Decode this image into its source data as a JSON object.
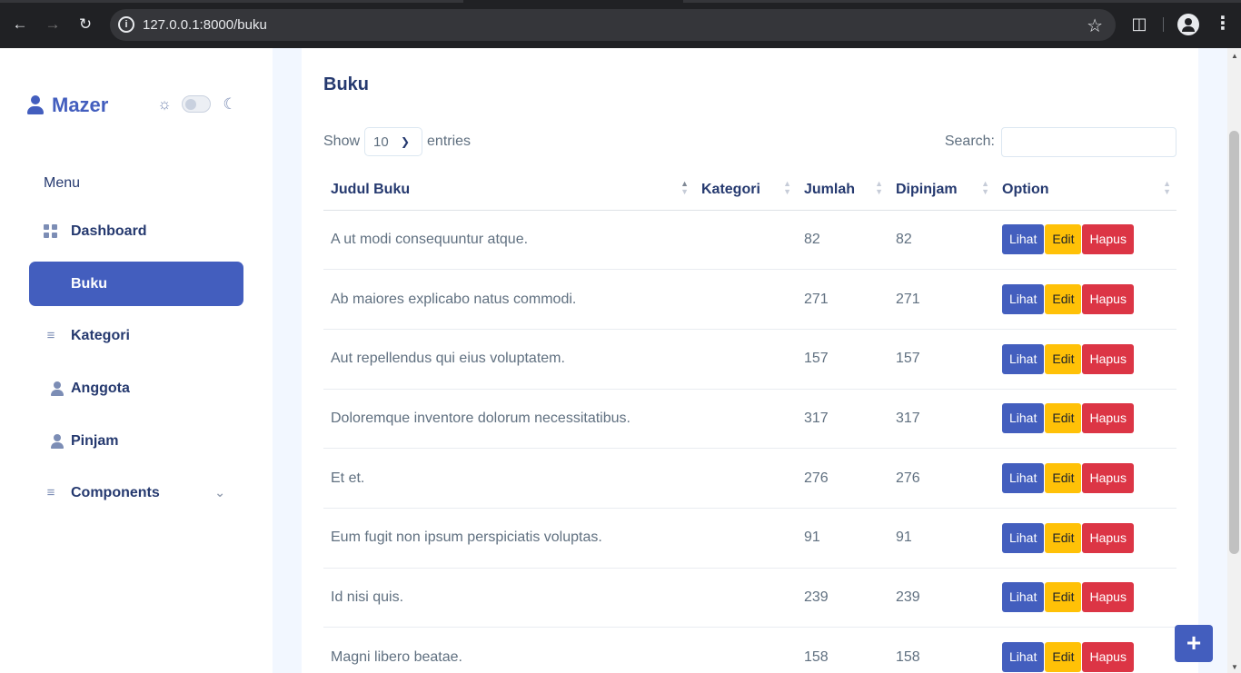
{
  "browser": {
    "url": "127.0.0.1:8000/buku"
  },
  "sidebar": {
    "brand": "Mazer",
    "menu_title": "Menu",
    "items": [
      {
        "label": "Dashboard"
      },
      {
        "label": "Buku"
      },
      {
        "label": "Kategori"
      },
      {
        "label": "Anggota"
      },
      {
        "label": "Pinjam"
      },
      {
        "label": "Components"
      }
    ],
    "active_item": "Buku"
  },
  "main": {
    "title": "Buku",
    "show_label": "Show",
    "entries_value": "10",
    "entries_label": "entries",
    "search_label": "Search:",
    "search_value": "",
    "columns": [
      "Judul Buku",
      "Kategori",
      "Jumlah",
      "Dipinjam",
      "Option"
    ],
    "rows": [
      {
        "judul": "A ut modi consequuntur atque.",
        "kategori": "",
        "jumlah": "82",
        "dipinjam": "82"
      },
      {
        "judul": "Ab maiores explicabo natus commodi.",
        "kategori": "",
        "jumlah": "271",
        "dipinjam": "271"
      },
      {
        "judul": "Aut repellendus qui eius voluptatem.",
        "kategori": "",
        "jumlah": "157",
        "dipinjam": "157"
      },
      {
        "judul": "Doloremque inventore dolorum necessitatibus.",
        "kategori": "",
        "jumlah": "317",
        "dipinjam": "317"
      },
      {
        "judul": "Et et.",
        "kategori": "",
        "jumlah": "276",
        "dipinjam": "276"
      },
      {
        "judul": "Eum fugit non ipsum perspiciatis voluptas.",
        "kategori": "",
        "jumlah": "91",
        "dipinjam": "91"
      },
      {
        "judul": "Id nisi quis.",
        "kategori": "",
        "jumlah": "239",
        "dipinjam": "239"
      },
      {
        "judul": "Magni libero beatae.",
        "kategori": "",
        "jumlah": "158",
        "dipinjam": "158"
      }
    ],
    "actions": {
      "view": "Lihat",
      "edit": "Edit",
      "delete": "Hapus"
    }
  },
  "fab": {
    "label": "+"
  },
  "colors": {
    "primary": "#435ebe",
    "warning": "#ffc107",
    "danger": "#dc3545",
    "heading": "#25396f",
    "text": "#607080"
  }
}
